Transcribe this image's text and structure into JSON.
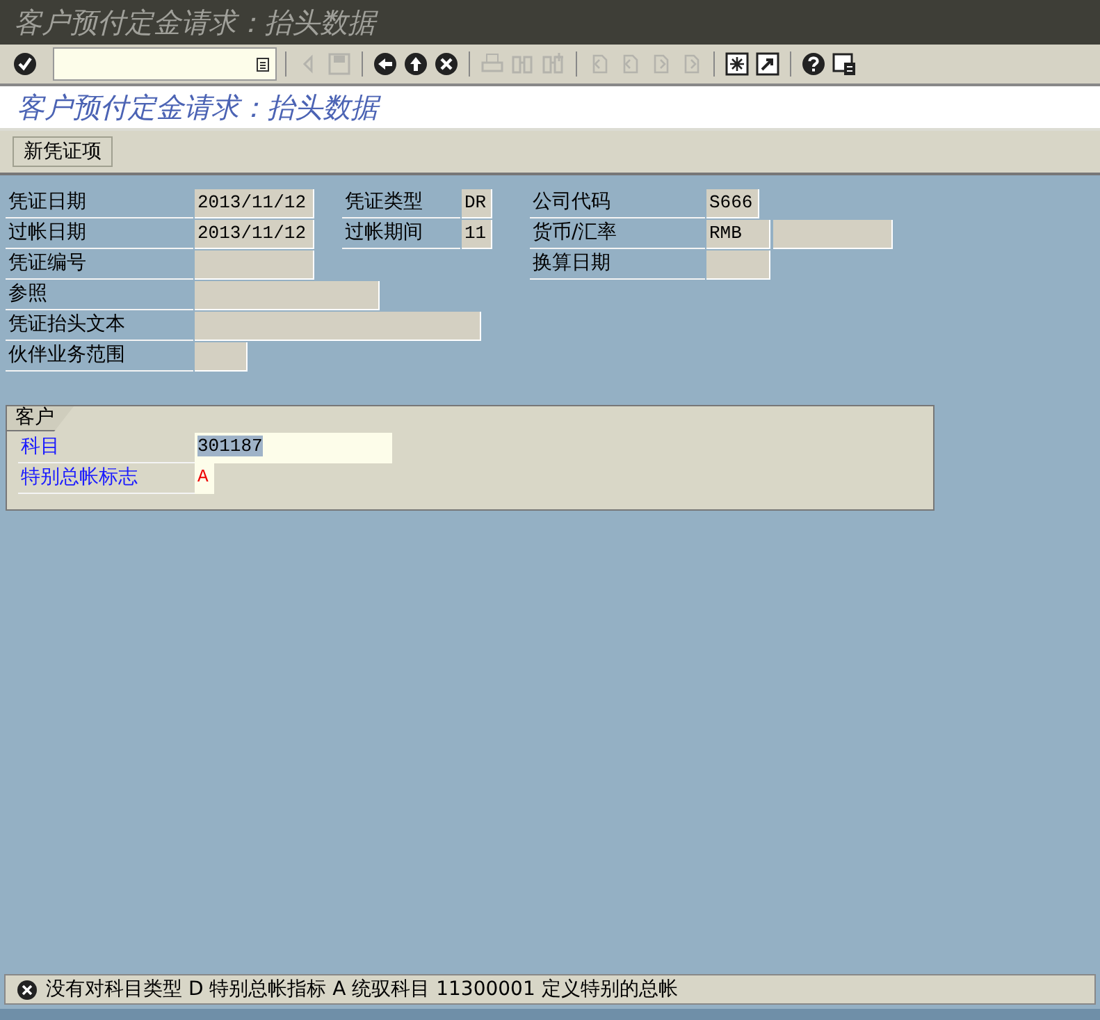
{
  "window": {
    "title": "客户预付定金请求：抬头数据"
  },
  "toolbar": {
    "buttons": [
      {
        "disabled": false
      },
      {
        "disabled": true
      },
      {
        "disabled": true
      },
      {
        "disabled": false
      },
      {
        "disabled": false
      },
      {
        "disabled": false
      },
      {
        "disabled": true
      },
      {
        "disabled": true
      },
      {
        "disabled": true
      },
      {
        "disabled": true
      },
      {
        "disabled": true
      },
      {
        "disabled": true
      },
      {
        "disabled": true
      },
      {
        "disabled": false
      },
      {
        "disabled": false
      },
      {
        "disabled": false
      },
      {
        "disabled": false
      }
    ]
  },
  "screen_title": "客户预付定金请求：抬头数据",
  "app_toolbar": {
    "buttons": [
      "新凭证项"
    ]
  },
  "header_fields": [
    {
      "left": {
        "label": "凭证日期",
        "value": "2013/11/12"
      },
      "middle": {
        "label": "凭证类型",
        "value": "DR"
      },
      "right": {
        "label": "公司代码",
        "value": "S666"
      }
    },
    {
      "left": {
        "label": "过帐日期",
        "value": "2013/11/12"
      },
      "middle": {
        "label": "过帐期间",
        "value": "11"
      },
      "right": {
        "label": "货币/汇率",
        "value": "RMB",
        "has_second_field": true
      }
    },
    {
      "left": {
        "label": "凭证编号"
      },
      "right": {
        "label": "换算日期"
      }
    },
    {
      "left": {
        "label": "参照"
      }
    },
    {
      "left": {
        "label": "凭证抬头文本"
      }
    },
    {
      "left": {
        "label": "伙伴业务范围"
      }
    }
  ],
  "customer_group": {
    "title": "客户",
    "fields": [
      {
        "label": "科目",
        "value": "301187",
        "selected": true,
        "error": false
      },
      {
        "label": "特别总帐标志",
        "value": "A",
        "selected": false,
        "error": true
      }
    ]
  },
  "status_bar": {
    "kind": "error",
    "message": "没有对科目类型 D 特别总帐指标 A 统驭科目 11300001 定义特别的总帐"
  }
}
